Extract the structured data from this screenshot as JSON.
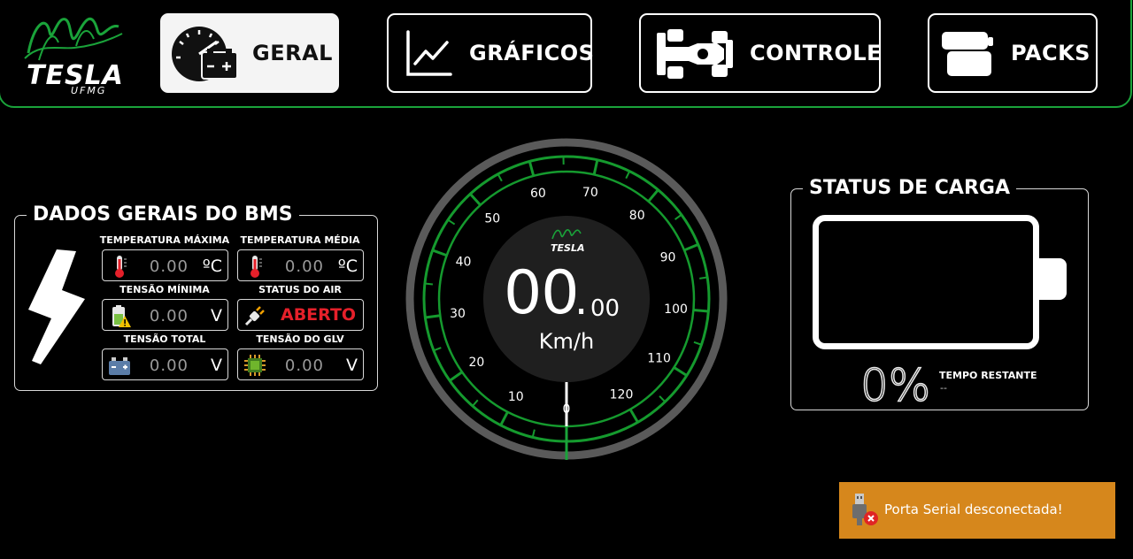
{
  "app": {
    "logo_text": "TESLA",
    "logo_sub": "UFMG",
    "accent_color": "#1aa33a"
  },
  "nav": {
    "items": [
      {
        "label": "GERAL",
        "icon": "gauge-battery-icon",
        "active": true
      },
      {
        "label": "GRÁFICOS",
        "icon": "line-chart-icon",
        "active": false
      },
      {
        "label": "CONTROLE",
        "icon": "race-car-icon",
        "active": false
      },
      {
        "label": "PACKS",
        "icon": "battery-packs-icon",
        "active": false
      }
    ]
  },
  "bms": {
    "title": "DADOS GERAIS DO BMS",
    "temp_max": {
      "label": "TEMPERATURA MÁXIMA",
      "value": "0.00",
      "unit": "ºC"
    },
    "temp_med": {
      "label": "TEMPERATURA MÉDIA",
      "value": "0.00",
      "unit": "ºC"
    },
    "tensao_min": {
      "label": "TENSÃO MÍNIMA",
      "value": "0.00",
      "unit": "V"
    },
    "status_air": {
      "label": "STATUS DO AIR",
      "value": "ABERTO"
    },
    "tensao_total": {
      "label": "TENSÃO TOTAL",
      "value": "0.00",
      "unit": "V"
    },
    "tensao_glv": {
      "label": "TENSÃO DO GLV",
      "value": "0.00",
      "unit": "V"
    }
  },
  "speedometer": {
    "speed_int": "00",
    "speed_dec": "00",
    "dot": ".",
    "unit": "Km/h",
    "ticks": [
      "0",
      "10",
      "20",
      "30",
      "40",
      "50",
      "60",
      "70",
      "80",
      "90",
      "100",
      "110",
      "120"
    ],
    "value": 0
  },
  "charge": {
    "title": "STATUS DE CARGA",
    "percent_label": "0%",
    "level": 0,
    "tempo_label": "TEMPO RESTANTE",
    "tempo_value": "--"
  },
  "toast": {
    "message": "Porta Serial desconectada!",
    "icon": "usb-disconnected-icon",
    "color": "#d6871c"
  }
}
